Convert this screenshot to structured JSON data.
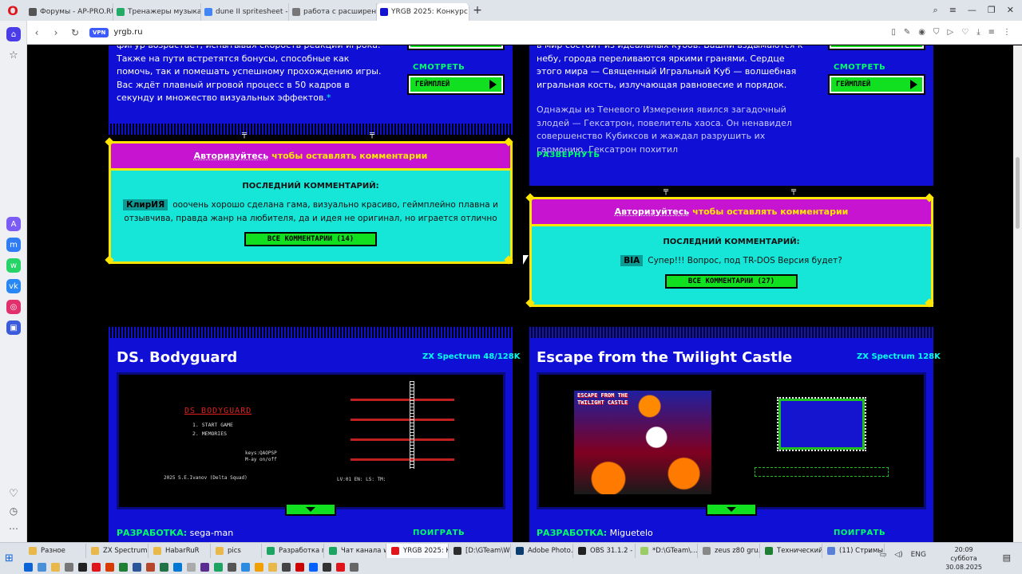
{
  "browser": {
    "tabs": [
      {
        "label": "Форумы - AP-PRO.RU",
        "active": false
      },
      {
        "label": "Тренажеры музыкально…",
        "active": false
      },
      {
        "label": "dune II spritesheet - Пои…",
        "active": false
      },
      {
        "label": "работа с расширенной…",
        "active": false
      },
      {
        "label": "YRGB 2025: Конкурс разр…",
        "active": true
      }
    ],
    "url": "yrgb.ru",
    "vpn_label": "VPN"
  },
  "card_top_left": {
    "description": "фигур возрастает, испытывая скорость реакции игрока. Также на пути встретятся бонусы, способные как помочь, так и помешать успешному прохождению игры. Вас ждёт плавный игровой процесс в 50 кадров в секунду и множество визуальных эффектов.",
    "asterisk": "*",
    "watch_label": "СМОТРЕТЬ",
    "gameplay_btn": "ГЕЙМПЛЕЙ"
  },
  "card_top_right": {
    "description": "в мир состоит из идеальных кубов. Башни вздымаются к небу, города переливаются яркими гранями. Сердце этого мира — Священный Игральный Куб — волшебная игральная кость, излучающая равновесие и порядок.",
    "description2": "Однажды из Теневого Измерения явился загадочный злодей — Гексатрон, повелитель хаоса. Он ненавидел совершенство Кубиксов и жаждал разрушить их гармонию. Гексатрон похитил",
    "expand_label": "РАЗВЕРНУТЬ",
    "watch_label": "СМОТРЕТЬ",
    "gameplay_btn": "ГЕЙМПЛЕЙ"
  },
  "comments_left": {
    "login_link": "Авторизуйтесь",
    "login_text": "чтобы оставлять комментарии",
    "last_comment_label": "ПОСЛЕДНИЙ КОММЕНТАРИЙ:",
    "author": "КлирИЯ",
    "text": "ооочень хорошо сделана гама, визуально красиво, геймплейно плавна и отзывчива, правда жанр на любителя, да и идея не оригинал, но играется отлично",
    "all_btn": "ВСЕ КОММЕНТАРИИ (14)"
  },
  "comments_right": {
    "login_link": "Авторизуйтесь",
    "login_text": "чтобы оставлять комментарии",
    "last_comment_label": "ПОСЛЕДНИЙ КОММЕНТАРИЙ:",
    "author": "BIA",
    "text": "Супер!!! Вопрос, под TR-DOS Версия будет?",
    "all_btn": "ВСЕ КОММЕНТАРИИ (27)"
  },
  "game_left": {
    "title": "DS. Bodyguard",
    "platform": "ZX Spectrum 48/128K",
    "screen_title": "DS BODYGUARD",
    "menu1": "1. START GAME",
    "menu2": "2. MEMORIES",
    "keys": "keys:QAOPSP",
    "music": "M-ay on/off",
    "credit": "2025 S.E.Ivanov (Delta Squad)",
    "hud": "LV:01  EN:   LS:  TM:",
    "dev_label": "РАЗРАБОТКА:",
    "dev_name": "sega-man",
    "play_label": "ПОИГРАТЬ"
  },
  "game_right": {
    "title": "Escape from the Twilight Castle",
    "platform": "ZX Spectrum 128K",
    "screen_title": "ESCAPE FROM THE TWILIGHT CASTLE",
    "dev_label": "РАЗРАБОТКА:",
    "dev_name": "Miguetelo",
    "play_label": "ПОИГРАТЬ"
  },
  "taskbar": {
    "items": [
      "Разное",
      "ZX Spectrum",
      "HabarRuR",
      "pics",
      "Разработка п…",
      "Чат канала w…",
      "YRGB 2025: K…",
      "[D:\\GTeam\\W…",
      "Adobe Photo…",
      "OBS 31.1.2 - …",
      "*D:\\GTeam\\…",
      "zeus z80 gru…",
      "Технический…",
      "(11) Стримы …"
    ],
    "lang": "ENG",
    "time": "20:09",
    "day": "суббота",
    "date": "30.08.2025"
  },
  "colors": {
    "blue": "#0f0fd6",
    "green": "#11e020",
    "magenta": "#c714d1",
    "cyan": "#15e6d8",
    "yellow": "#ffe600"
  }
}
